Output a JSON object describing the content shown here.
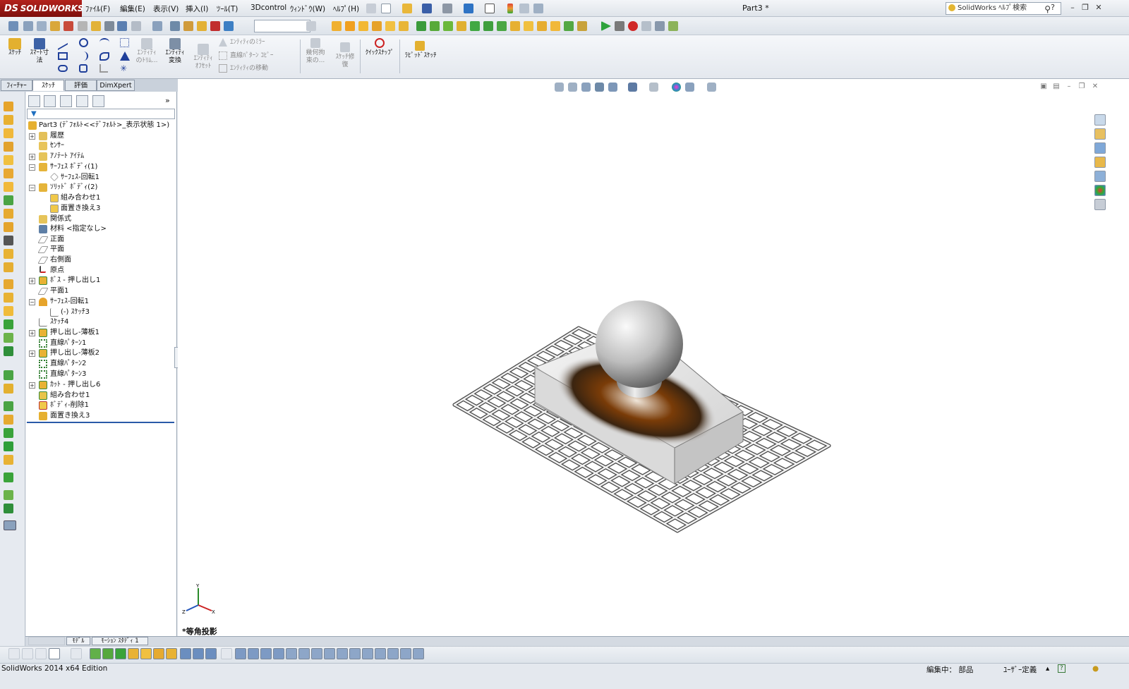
{
  "app": {
    "logo_text": "SOLIDWORKS",
    "logo_mark": "DS",
    "document_title": "Part3 *",
    "help_search_placeholder": "SolidWorks ﾍﾙﾌﾟ検索",
    "help_icon": "?"
  },
  "menu": [
    "ﾌｧｲﾙ(F)",
    "編集(E)",
    "表示(V)",
    "挿入(I)",
    "ﾂｰﾙ(T)",
    "3Dcontrol",
    "ｳｨﾝﾄﾞｳ(W)",
    "ﾍﾙﾌﾟ(H)"
  ],
  "command_manager": {
    "sketch": "ｽｹｯﾁ",
    "smart_dimension_1": "ｽﾏｰﾄ寸",
    "smart_dimension_2": "法",
    "trim_1": "ｴﾝﾃｨﾃｨ",
    "trim_2": "のﾄﾘﾑ...",
    "convert_1": "ｴﾝﾃｨﾃｨ",
    "convert_2": "変換",
    "offset_1": "ｴﾝﾃｨﾃｨ",
    "offset_2": "ｵﾌｾｯﾄ",
    "mirror": "ｴﾝﾃｨﾃｨのﾐﾗｰ",
    "linear_pattern": "直線ﾊﾟﾀｰﾝ ｺﾋﾟｰ",
    "move": "ｴﾝﾃｨﾃｨの移動",
    "relations_1": "幾何拘",
    "relations_2": "束の...",
    "repair_1": "ｽｹｯﾁ修",
    "repair_2": "復",
    "quick_snap": "ｸｲｯｸｽﾅｯﾌﾟ",
    "rapid_sketch": "ﾗﾋﾟｯﾄﾞｽｹｯﾁ"
  },
  "left_tabs": [
    "ﾌｨｰﾁｬｰ",
    "ｽｹｯﾁ",
    "評価",
    "DimXpert"
  ],
  "tree": {
    "root": "Part3  (ﾃﾞﾌｫﾙﾄ<<ﾃﾞﾌｫﾙﾄ>_表示状態 1>)",
    "items": [
      "履歴",
      "ｾﾝｻｰ",
      "ｱﾉﾃｰﾄ ｱｲﾃﾑ",
      "ｻｰﾌｪｽ ﾎﾞﾃﾞｨ(1)",
      "ｻｰﾌｪｽ-回転1",
      "ｿﾘｯﾄﾞ ﾎﾞﾃﾞｨ(2)",
      "組み合わせ1",
      "面置き換え3",
      "関係式",
      "材料 <指定なし>",
      "正面",
      "平面",
      "右側面",
      "原点",
      "ﾎﾞｽ - 押し出し1",
      "平面1",
      "ｻｰﾌｪｽ-回転1",
      "(-) ｽｹｯﾁ3",
      "ｽｹｯﾁ4",
      "押し出し-薄板1",
      "直線ﾊﾟﾀｰﾝ1",
      "押し出し-薄板2",
      "直線ﾊﾟﾀｰﾝ2",
      "直線ﾊﾟﾀｰﾝ3",
      "ｶｯﾄ - 押し出し6",
      "組み合わせ1",
      "ﾎﾞﾃﾞｨ-削除1",
      "面置き換え3"
    ]
  },
  "viewport": {
    "view_label": "*等角投影"
  },
  "bottom_tabs": [
    "ﾓﾃﾞﾙ",
    "ﾓｰｼｮﾝ ｽﾀﾃﾞｨ 1"
  ],
  "status": {
    "edition": "SolidWorks 2014 x64 Edition",
    "editing": "編集中：  部品",
    "units": "ﾕｰｻﾞｰ定義",
    "help": "?"
  },
  "colors": {
    "logo_red": "#a61b16",
    "model_gray": "#c8c8c8",
    "shadow_orange": "#8a4a10"
  }
}
